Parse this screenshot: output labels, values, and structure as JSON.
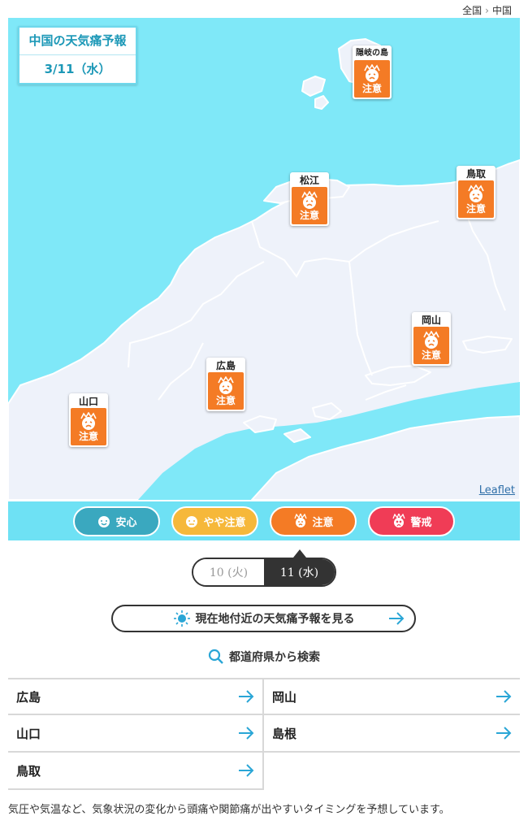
{
  "breadcrumb": {
    "home": "全国",
    "current": "中国"
  },
  "forecast": {
    "title": "中国の天気痛予報",
    "date": "3/11（水）"
  },
  "markers": [
    {
      "name": "隠岐の島",
      "level": "注意"
    },
    {
      "name": "松江",
      "level": "注意"
    },
    {
      "name": "鳥取",
      "level": "注意"
    },
    {
      "name": "岡山",
      "level": "注意"
    },
    {
      "name": "広島",
      "level": "注意"
    },
    {
      "name": "山口",
      "level": "注意"
    }
  ],
  "map_attribution": "Leaflet",
  "legend": [
    {
      "label": "安心",
      "color": "#3aa8bf"
    },
    {
      "label": "やや注意",
      "color": "#f6b83a"
    },
    {
      "label": "注意",
      "color": "#f47b25"
    },
    {
      "label": "警戒",
      "color": "#f03c56"
    }
  ],
  "date_tabs": [
    {
      "label": "10 (火)",
      "selected": false
    },
    {
      "label": "11 (水)",
      "selected": true
    }
  ],
  "current_location_button": "現在地付近の天気痛予報を見る",
  "search_label": "都道府県から検索",
  "prefectures": [
    "広島",
    "岡山",
    "山口",
    "島根",
    "鳥取"
  ],
  "footnote": "気圧や気温など、気象状況の変化から頭痛や関節痛が出やすいタイミングを予想しています。",
  "colors": {
    "sea": "#7fe8f8",
    "land": "#eef2fa",
    "border": "#ffffff",
    "accent": "#1c98b7"
  }
}
